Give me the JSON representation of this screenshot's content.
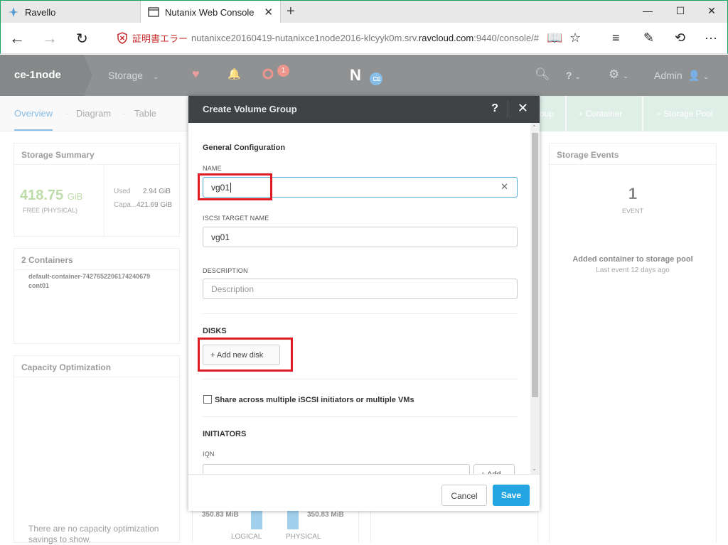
{
  "browser": {
    "tabs": [
      {
        "label": "Ravello"
      },
      {
        "label": "Nutanix Web Console"
      }
    ],
    "cert_error": "証明書エラー",
    "url_prefix": "nutanixce20160419-nutanixce1node2016-klcyyk0m.srv.",
    "url_domain": "ravcloud.com",
    "url_suffix": ":9440/console/#"
  },
  "app": {
    "cluster_name": "ce-1node",
    "nav_storage": "Storage",
    "alert_count": "1",
    "logo_badge": "CE",
    "user": "Admin",
    "subnav": {
      "overview": "Overview",
      "diagram": "Diagram",
      "table": "Table",
      "btn_group_partial": "oup",
      "btn_container": "+ Container",
      "btn_storage_pool": "+ Storage Pool"
    },
    "storage_summary": {
      "title": "Storage Summary",
      "free_value": "418.75",
      "free_unit": "GiB",
      "free_label": "FREE (PHYSICAL)",
      "used_label": "Used",
      "used_value": "2.94 GiB",
      "capa_label": "Capa...",
      "capa_value": "421.69 GiB"
    },
    "containers": {
      "title": "2 Containers",
      "items": [
        "default-container-74276522061742406​79",
        "cont01"
      ]
    },
    "capacity": {
      "title": "Capacity Optimization",
      "message": "There are no capacity optimization savings to show."
    },
    "storage_events": {
      "title": "Storage Events",
      "count": "1",
      "count_label": "EVENT",
      "latest": "Added container to storage pool",
      "latest_time": "Last event 12 days ago"
    },
    "bottom": {
      "left_val": "350.83 MiB",
      "right_val": "350.83 MiB",
      "left_lbl": "LOGICAL",
      "right_lbl": "PHYSICAL"
    }
  },
  "modal": {
    "title": "Create Volume Group",
    "general_config": "General Configuration",
    "name_label": "NAME",
    "name_value": "vg01",
    "iscsi_label": "ISCSI TARGET NAME",
    "iscsi_value": "vg01",
    "desc_label": "DESCRIPTION",
    "desc_placeholder": "Description",
    "disks_label": "DISKS",
    "add_disk": "+ Add new disk",
    "share_label": "Share across multiple iSCSI initiators or multiple VMs",
    "initiators_label": "INITIATORS",
    "iqn_label": "IQN",
    "add_iqn": "+ Add",
    "cancel": "Cancel",
    "save": "Save"
  },
  "colors": {
    "header_dark": "#3f4346",
    "accent_blue": "#22a5e0",
    "highlight_red": "#e01b24",
    "free_green": "#8ec36b"
  }
}
